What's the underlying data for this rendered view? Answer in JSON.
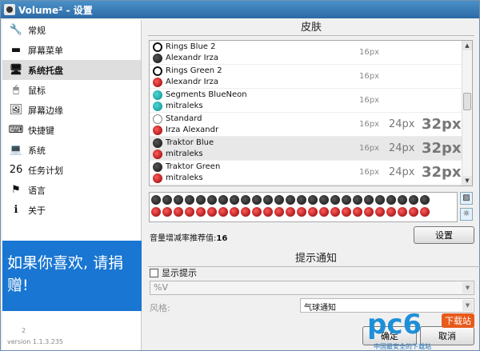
{
  "window": {
    "title": "Volume² - 设置"
  },
  "sidebar": {
    "items": [
      {
        "label": "常规",
        "icon": "tools-icon",
        "glyph": "🔧",
        "active": false
      },
      {
        "label": "屏幕菜单",
        "icon": "screen-menu-icon",
        "glyph": "▬",
        "active": false
      },
      {
        "label": "系统托盘",
        "icon": "tray-icon",
        "glyph": "🖥",
        "active": true
      },
      {
        "label": "鼠标",
        "icon": "mouse-icon",
        "glyph": "🖱",
        "active": false
      },
      {
        "label": "屏幕边缘",
        "icon": "screen-edge-icon",
        "glyph": "🖼",
        "active": false
      },
      {
        "label": "快捷键",
        "icon": "keyboard-icon",
        "glyph": "⌨",
        "active": false
      },
      {
        "label": "系统",
        "icon": "system-icon",
        "glyph": "💻",
        "active": false
      },
      {
        "label": "任务计划",
        "icon": "calendar-icon",
        "glyph": "26",
        "active": false
      },
      {
        "label": "语言",
        "icon": "language-icon",
        "glyph": "⚑",
        "active": false
      },
      {
        "label": "关于",
        "icon": "info-icon",
        "glyph": "ℹ",
        "active": false
      }
    ],
    "donate_text": "如果你喜欢, 请捐赠!",
    "version": "version 1.1.3.235",
    "version_sup": "2"
  },
  "skins": {
    "header": "皮肤",
    "rows": [
      {
        "name": "Rings Blue 2",
        "author": "Alexandr Irza",
        "s16": "16px",
        "s24": "",
        "s32": "",
        "icon1": "k-ring",
        "icon2": "k-dark"
      },
      {
        "name": "Rings Green 2",
        "author": "Alexandr Irza",
        "s16": "16px",
        "s24": "",
        "s32": "",
        "icon1": "k-ring",
        "icon2": "k-red"
      },
      {
        "name": "Segments BlueNeon",
        "author": "mitraleks",
        "s16": "16px",
        "s24": "",
        "s32": "",
        "icon1": "k-teal",
        "icon2": "k-teal"
      },
      {
        "name": "Standard",
        "author": "Irza Alexandr",
        "s16": "16px",
        "s24": "24px",
        "s32": "32px",
        "icon1": "k-gray",
        "icon2": "k-red"
      },
      {
        "name": "Traktor Blue",
        "author": "mitraleks",
        "s16": "16px",
        "s24": "24px",
        "s32": "32px",
        "icon1": "k-dark",
        "icon2": "k-red",
        "highlight": true
      },
      {
        "name": "Traktor Green",
        "author": "mitraleks",
        "s16": "16px",
        "s24": "24px",
        "s32": "32px",
        "icon1": "k-dark",
        "icon2": "k-red"
      }
    ]
  },
  "gain": {
    "label": "音量增减率推荐值:",
    "value": "16"
  },
  "settings_button": "设置",
  "notify": {
    "header": "提示通知",
    "show_tips": "显示提示",
    "format_value": "%V",
    "style_label": "风格:",
    "style_value": "气球通知"
  },
  "bottom_buttons": {
    "ok": "确定",
    "cancel": "取消"
  },
  "watermark": {
    "logo": "pc6",
    "badge": "下载站",
    "sub": "中国最安全的下载站"
  }
}
